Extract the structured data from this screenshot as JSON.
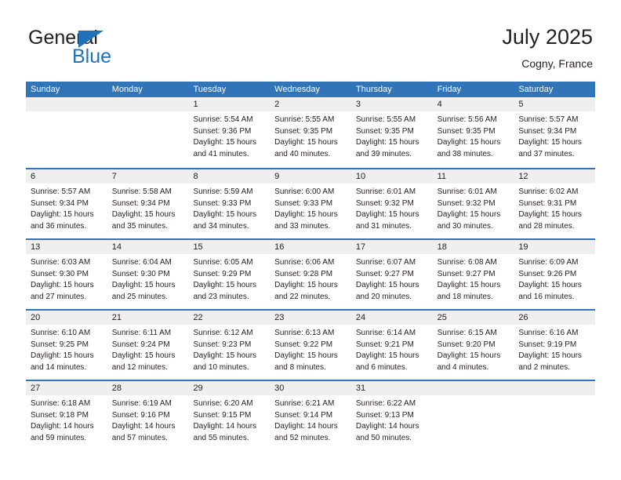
{
  "brand": {
    "name_top": "General",
    "name_bottom": "Blue",
    "flag_icon": "triangle-flag-icon",
    "accent_color": "#1f72b8"
  },
  "header": {
    "title": "July 2025",
    "subtitle": "Cogny, France"
  },
  "theme": {
    "header_blue": "#3175b8",
    "day_band_gray": "#efefef",
    "text": "#231f20"
  },
  "weekdays": [
    "Sunday",
    "Monday",
    "Tuesday",
    "Wednesday",
    "Thursday",
    "Friday",
    "Saturday"
  ],
  "weeks": [
    [
      {
        "day": "",
        "lines": []
      },
      {
        "day": "",
        "lines": []
      },
      {
        "day": "1",
        "lines": [
          "Sunrise: 5:54 AM",
          "Sunset: 9:36 PM",
          "Daylight: 15 hours",
          "and 41 minutes."
        ]
      },
      {
        "day": "2",
        "lines": [
          "Sunrise: 5:55 AM",
          "Sunset: 9:35 PM",
          "Daylight: 15 hours",
          "and 40 minutes."
        ]
      },
      {
        "day": "3",
        "lines": [
          "Sunrise: 5:55 AM",
          "Sunset: 9:35 PM",
          "Daylight: 15 hours",
          "and 39 minutes."
        ]
      },
      {
        "day": "4",
        "lines": [
          "Sunrise: 5:56 AM",
          "Sunset: 9:35 PM",
          "Daylight: 15 hours",
          "and 38 minutes."
        ]
      },
      {
        "day": "5",
        "lines": [
          "Sunrise: 5:57 AM",
          "Sunset: 9:34 PM",
          "Daylight: 15 hours",
          "and 37 minutes."
        ]
      }
    ],
    [
      {
        "day": "6",
        "lines": [
          "Sunrise: 5:57 AM",
          "Sunset: 9:34 PM",
          "Daylight: 15 hours",
          "and 36 minutes."
        ]
      },
      {
        "day": "7",
        "lines": [
          "Sunrise: 5:58 AM",
          "Sunset: 9:34 PM",
          "Daylight: 15 hours",
          "and 35 minutes."
        ]
      },
      {
        "day": "8",
        "lines": [
          "Sunrise: 5:59 AM",
          "Sunset: 9:33 PM",
          "Daylight: 15 hours",
          "and 34 minutes."
        ]
      },
      {
        "day": "9",
        "lines": [
          "Sunrise: 6:00 AM",
          "Sunset: 9:33 PM",
          "Daylight: 15 hours",
          "and 33 minutes."
        ]
      },
      {
        "day": "10",
        "lines": [
          "Sunrise: 6:01 AM",
          "Sunset: 9:32 PM",
          "Daylight: 15 hours",
          "and 31 minutes."
        ]
      },
      {
        "day": "11",
        "lines": [
          "Sunrise: 6:01 AM",
          "Sunset: 9:32 PM",
          "Daylight: 15 hours",
          "and 30 minutes."
        ]
      },
      {
        "day": "12",
        "lines": [
          "Sunrise: 6:02 AM",
          "Sunset: 9:31 PM",
          "Daylight: 15 hours",
          "and 28 minutes."
        ]
      }
    ],
    [
      {
        "day": "13",
        "lines": [
          "Sunrise: 6:03 AM",
          "Sunset: 9:30 PM",
          "Daylight: 15 hours",
          "and 27 minutes."
        ]
      },
      {
        "day": "14",
        "lines": [
          "Sunrise: 6:04 AM",
          "Sunset: 9:30 PM",
          "Daylight: 15 hours",
          "and 25 minutes."
        ]
      },
      {
        "day": "15",
        "lines": [
          "Sunrise: 6:05 AM",
          "Sunset: 9:29 PM",
          "Daylight: 15 hours",
          "and 23 minutes."
        ]
      },
      {
        "day": "16",
        "lines": [
          "Sunrise: 6:06 AM",
          "Sunset: 9:28 PM",
          "Daylight: 15 hours",
          "and 22 minutes."
        ]
      },
      {
        "day": "17",
        "lines": [
          "Sunrise: 6:07 AM",
          "Sunset: 9:27 PM",
          "Daylight: 15 hours",
          "and 20 minutes."
        ]
      },
      {
        "day": "18",
        "lines": [
          "Sunrise: 6:08 AM",
          "Sunset: 9:27 PM",
          "Daylight: 15 hours",
          "and 18 minutes."
        ]
      },
      {
        "day": "19",
        "lines": [
          "Sunrise: 6:09 AM",
          "Sunset: 9:26 PM",
          "Daylight: 15 hours",
          "and 16 minutes."
        ]
      }
    ],
    [
      {
        "day": "20",
        "lines": [
          "Sunrise: 6:10 AM",
          "Sunset: 9:25 PM",
          "Daylight: 15 hours",
          "and 14 minutes."
        ]
      },
      {
        "day": "21",
        "lines": [
          "Sunrise: 6:11 AM",
          "Sunset: 9:24 PM",
          "Daylight: 15 hours",
          "and 12 minutes."
        ]
      },
      {
        "day": "22",
        "lines": [
          "Sunrise: 6:12 AM",
          "Sunset: 9:23 PM",
          "Daylight: 15 hours",
          "and 10 minutes."
        ]
      },
      {
        "day": "23",
        "lines": [
          "Sunrise: 6:13 AM",
          "Sunset: 9:22 PM",
          "Daylight: 15 hours",
          "and 8 minutes."
        ]
      },
      {
        "day": "24",
        "lines": [
          "Sunrise: 6:14 AM",
          "Sunset: 9:21 PM",
          "Daylight: 15 hours",
          "and 6 minutes."
        ]
      },
      {
        "day": "25",
        "lines": [
          "Sunrise: 6:15 AM",
          "Sunset: 9:20 PM",
          "Daylight: 15 hours",
          "and 4 minutes."
        ]
      },
      {
        "day": "26",
        "lines": [
          "Sunrise: 6:16 AM",
          "Sunset: 9:19 PM",
          "Daylight: 15 hours",
          "and 2 minutes."
        ]
      }
    ],
    [
      {
        "day": "27",
        "lines": [
          "Sunrise: 6:18 AM",
          "Sunset: 9:18 PM",
          "Daylight: 14 hours",
          "and 59 minutes."
        ]
      },
      {
        "day": "28",
        "lines": [
          "Sunrise: 6:19 AM",
          "Sunset: 9:16 PM",
          "Daylight: 14 hours",
          "and 57 minutes."
        ]
      },
      {
        "day": "29",
        "lines": [
          "Sunrise: 6:20 AM",
          "Sunset: 9:15 PM",
          "Daylight: 14 hours",
          "and 55 minutes."
        ]
      },
      {
        "day": "30",
        "lines": [
          "Sunrise: 6:21 AM",
          "Sunset: 9:14 PM",
          "Daylight: 14 hours",
          "and 52 minutes."
        ]
      },
      {
        "day": "31",
        "lines": [
          "Sunrise: 6:22 AM",
          "Sunset: 9:13 PM",
          "Daylight: 14 hours",
          "and 50 minutes."
        ]
      },
      {
        "day": "",
        "lines": []
      },
      {
        "day": "",
        "lines": []
      }
    ]
  ]
}
